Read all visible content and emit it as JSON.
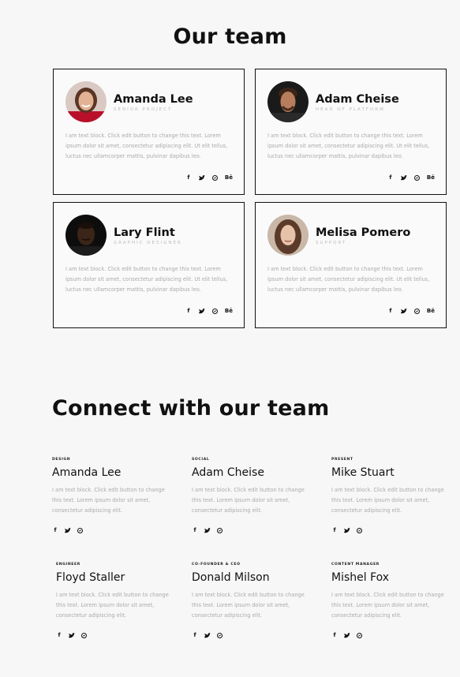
{
  "our_team": {
    "title": "Our team",
    "cards": [
      {
        "name": "Amanda Lee",
        "role": "Senior Project",
        "desc": "I am text block. Click edit button to change this text. Lorem ipsum dolor sit amet, consectetur adipiscing elit. Ut elit tellus, luctus nec ullamcorper mattis, pulvinar dapibus leo.",
        "avatar": "woman-red-shirt-avatar"
      },
      {
        "name": "Adam Cheise",
        "role": "Head of Platform",
        "desc": "I am text block. Click edit button to change this text. Lorem ipsum dolor sit amet, consectetur adipiscing elit. Ut elit tellus, luctus nec ullamcorper mattis, pulvinar dapibus leo.",
        "avatar": "man-dark-background-avatar"
      },
      {
        "name": "Lary Flint",
        "role": "Graphic Designer",
        "desc": "I am text block. Click edit button to change this text. Lorem ipsum dolor sit amet, consectetur adipiscing elit. Ut elit tellus, luctus nec ullamcorper mattis, pulvinar dapibus leo.",
        "avatar": "man-black-background-avatar"
      },
      {
        "name": "Melisa Pomero",
        "role": "Support",
        "desc": "I am text block. Click edit button to change this text. Lorem ipsum dolor sit amet, consectetur adipiscing elit. Ut elit tellus, luctus nec ullamcorper mattis, pulvinar dapibus leo.",
        "avatar": "woman-long-hair-avatar"
      }
    ],
    "social": [
      "f",
      "facebook-icon",
      "twitter-icon",
      "dribbble-icon",
      "Bē"
    ]
  },
  "connect": {
    "title": "Connect with our team",
    "members": [
      {
        "tag": "Design",
        "name": "Amanda Lee",
        "desc": "I am text block. Click edit button to change this text. Lorem ipsum dolor sit amet, consectetur adipiscing elit."
      },
      {
        "tag": "Social",
        "name": "Adam Cheise",
        "desc": "I am text block. Click edit button to change this text. Lorem ipsum dolor sit amet, consectetur adipiscing elit."
      },
      {
        "tag": "Present",
        "name": "Mike Stuart",
        "desc": "I am text block. Click edit button to change this text. Lorem ipsum dolor sit amet, consectetur adipiscing elit."
      },
      {
        "tag": "Engineer",
        "name": "Floyd Staller",
        "desc": "I am text block. Click edit button to change this text. Lorem ipsum dolor sit amet, consectetur adipiscing elit."
      },
      {
        "tag": "Co-Founder & CEO",
        "name": "Donald Milson",
        "desc": "I am text block. Click edit button to change this text. Lorem ipsum dolor sit amet, consectetur adipiscing elit."
      },
      {
        "tag": "Content Manager",
        "name": "Mishel Fox",
        "desc": "I am text block. Click edit button to change this text. Lorem ipsum dolor sit amet, consectetur adipiscing elit."
      }
    ]
  },
  "icons": {
    "facebook": "f",
    "twitter": "🐦",
    "behance": "Bē"
  }
}
